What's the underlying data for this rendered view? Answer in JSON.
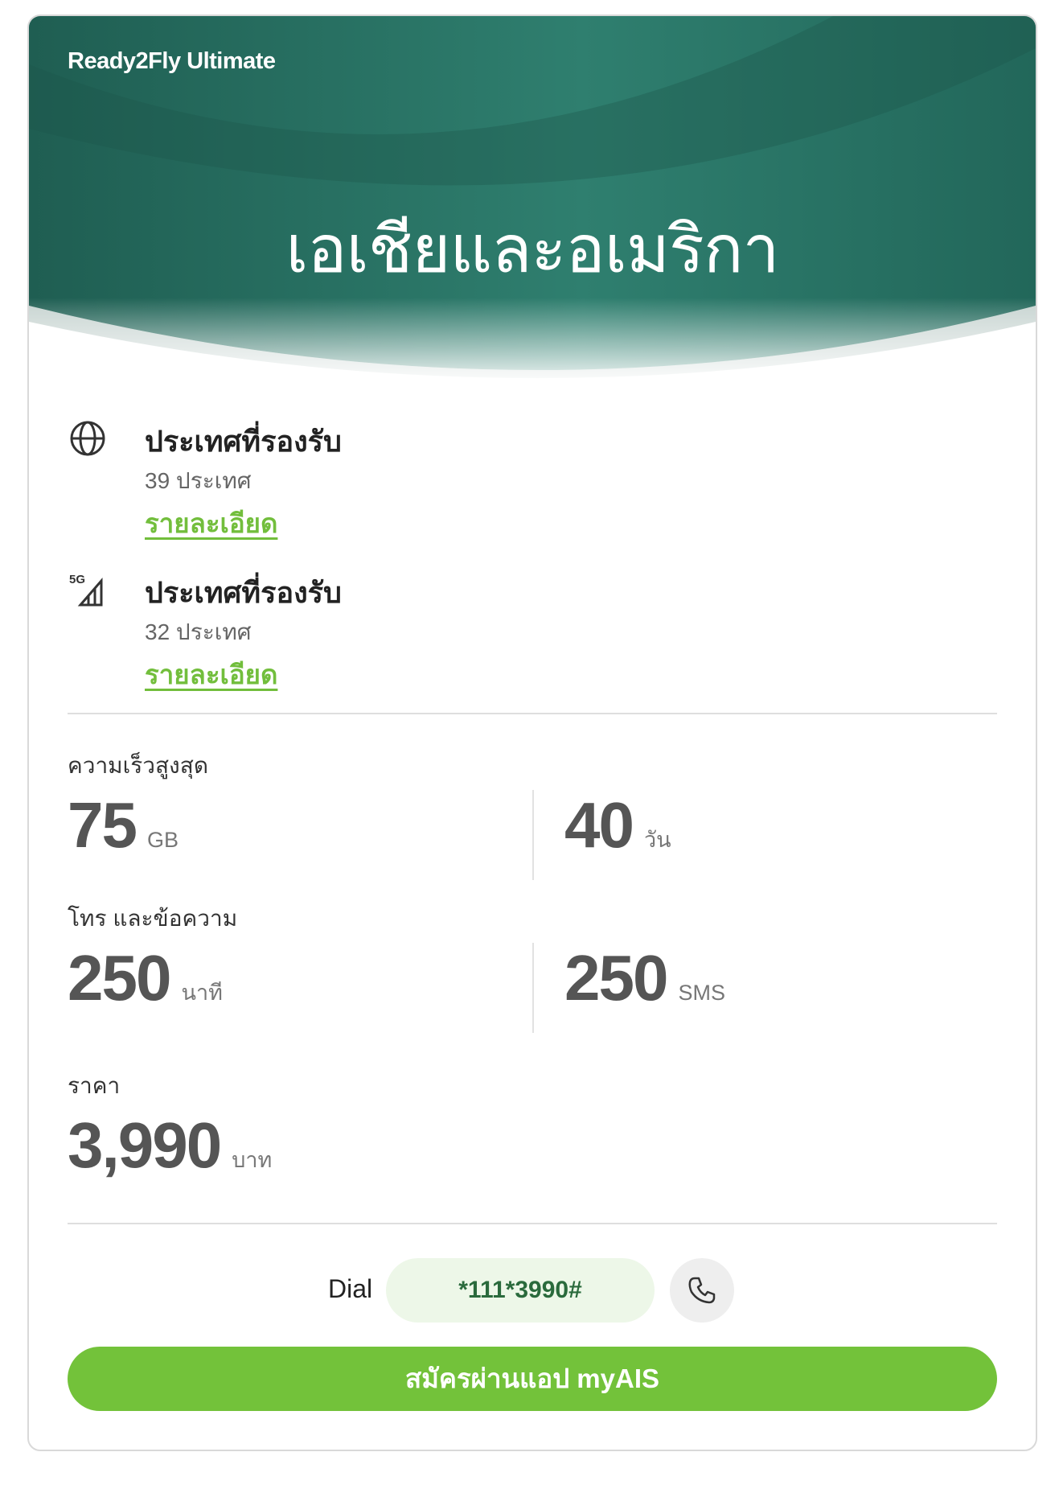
{
  "colors": {
    "hero_dark": "#1f5e52",
    "hero_light": "#2f7f6f",
    "accent_green": "#73c23a",
    "link_green": "#72be3c",
    "dial_bg": "#edf7e8"
  },
  "hero": {
    "subtitle": "Ready2Fly Ultimate",
    "title": "เอเชียและอเมริกา"
  },
  "features": [
    {
      "icon": "globe-icon",
      "title": "ประเทศที่รองรับ",
      "subtitle": "39 ประเทศ",
      "link": "รายละเอียด"
    },
    {
      "icon": "5g-signal-icon",
      "icon_text": "5G",
      "title": "ประเทศที่รองรับ",
      "subtitle": "32 ประเทศ",
      "link": "รายละเอียด"
    }
  ],
  "speed": {
    "label": "ความเร็วสูงสุด",
    "data_value": "75",
    "data_unit": "GB",
    "days_value": "40",
    "days_unit": "วัน"
  },
  "calls": {
    "label": "โทร และข้อความ",
    "minutes_value": "250",
    "minutes_unit": "นาที",
    "sms_value": "250",
    "sms_unit": "SMS"
  },
  "price": {
    "label": "ราคา",
    "value": "3,990",
    "unit": "บาท"
  },
  "dial": {
    "label": "Dial",
    "code": "*111*3990#",
    "call_icon": "phone-icon"
  },
  "cta": {
    "label": "สมัครผ่านแอป myAIS"
  }
}
